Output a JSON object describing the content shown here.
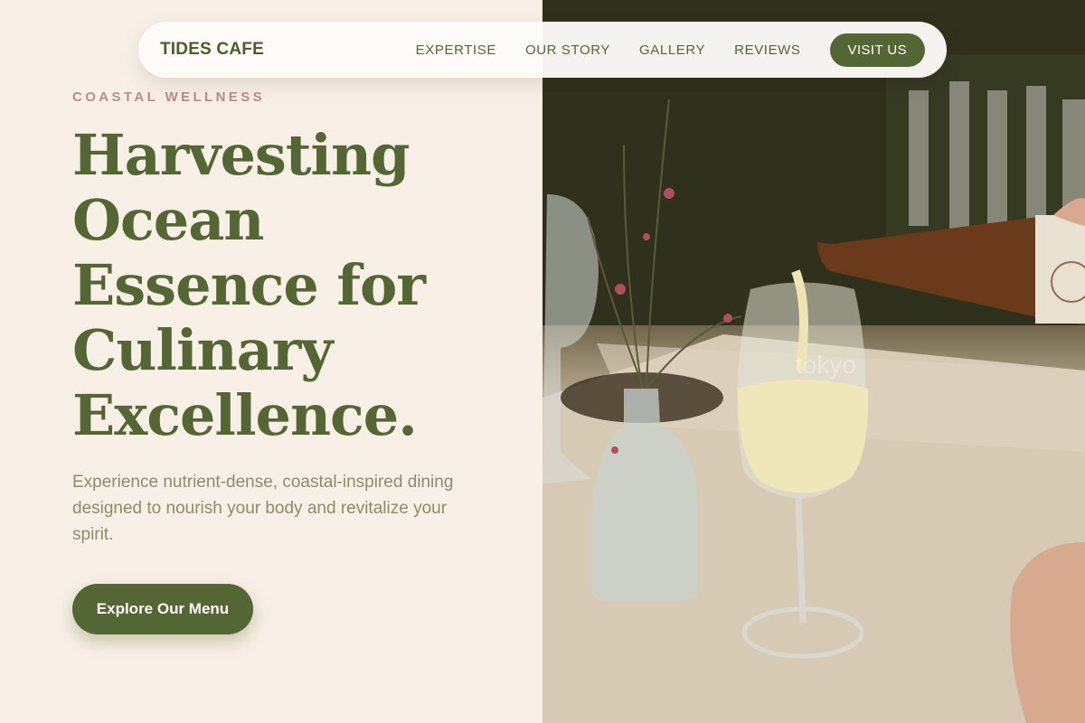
{
  "nav": {
    "brand": "TIDES CAFE",
    "links": [
      "EXPERTISE",
      "OUR STORY",
      "GALLERY",
      "REVIEWS"
    ],
    "cta": "VISIT US"
  },
  "hero": {
    "eyebrow": "COASTAL WELLNESS",
    "headline": "Harvesting Ocean Essence for Culinary Excellence.",
    "subtext": "Experience nutrient-dense, coastal-inspired dining designed to nourish your body and revitalize your spirit.",
    "button": "Explore Our Menu",
    "watermark": "tokyo"
  },
  "colors": {
    "accent": "#536633",
    "background": "#f8efe6",
    "eyebrow": "#b98b8b"
  },
  "icons": {
    "photo": "wine-pouring-photo"
  }
}
